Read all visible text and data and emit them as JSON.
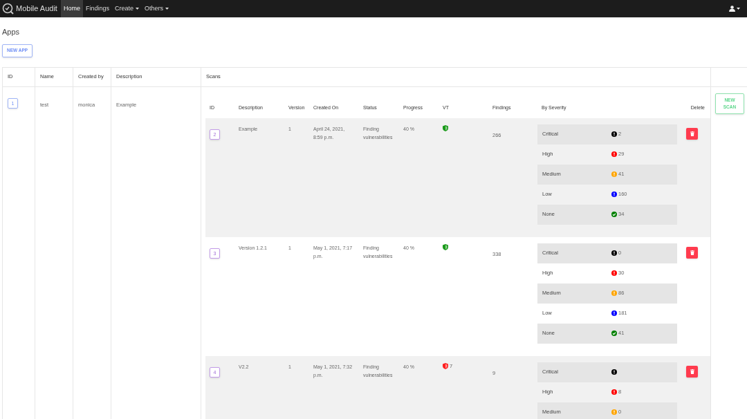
{
  "navbar": {
    "brand": "Mobile Audit",
    "items": [
      {
        "label": "Home",
        "selected": true,
        "dropdown": false
      },
      {
        "label": "Findings",
        "selected": false,
        "dropdown": false
      },
      {
        "label": "Create",
        "selected": false,
        "dropdown": true
      },
      {
        "label": "Others",
        "selected": false,
        "dropdown": true
      }
    ]
  },
  "page_title": "Apps",
  "new_app_button": "NEW APP",
  "apps_table": {
    "columns": [
      "ID",
      "Name",
      "Created by",
      "Description",
      "Scans"
    ],
    "rows": [
      {
        "id": "1",
        "name": "test",
        "created_by": "monica",
        "description": "Example",
        "new_scan_button": "NEW SCAN",
        "scans": {
          "columns": [
            "ID",
            "Description",
            "Version",
            "Created On",
            "Status",
            "Progress",
            "VT",
            "Findings",
            "By Severity",
            "Delete"
          ],
          "rows": [
            {
              "id": "2",
              "description": "Example",
              "version": "1",
              "created_on": "April 24, 2021, 8:59 p.m.",
              "status": "Finding vulnerabilities",
              "progress": "40 %",
              "vt": {
                "kind": "clean"
              },
              "findings": "266",
              "severity": [
                {
                  "label": "Critical",
                  "count": "2",
                  "color": "#000000",
                  "kind": "alert"
                },
                {
                  "label": "High",
                  "count": "29",
                  "color": "#ff0000",
                  "kind": "alert"
                },
                {
                  "label": "Medium",
                  "count": "41",
                  "color": "#ffa500",
                  "kind": "alert"
                },
                {
                  "label": "Low",
                  "count": "160",
                  "color": "#0000ff",
                  "kind": "alert"
                },
                {
                  "label": "None",
                  "count": "34",
                  "color": "#008000",
                  "kind": "check"
                }
              ]
            },
            {
              "id": "3",
              "description": "Version 1.2.1",
              "version": "1",
              "created_on": "May 1, 2021, 7:17 p.m.",
              "status": "Finding vulnerabilities",
              "progress": "40 %",
              "vt": {
                "kind": "clean"
              },
              "findings": "338",
              "severity": [
                {
                  "label": "Critical",
                  "count": "0",
                  "color": "#000000",
                  "kind": "alert"
                },
                {
                  "label": "High",
                  "count": "30",
                  "color": "#ff0000",
                  "kind": "alert"
                },
                {
                  "label": "Medium",
                  "count": "86",
                  "color": "#ffa500",
                  "kind": "alert"
                },
                {
                  "label": "Low",
                  "count": "181",
                  "color": "#0000ff",
                  "kind": "alert"
                },
                {
                  "label": "None",
                  "count": "41",
                  "color": "#008000",
                  "kind": "check"
                }
              ]
            },
            {
              "id": "4",
              "description": "V2.2",
              "version": "1",
              "created_on": "May 1, 2021, 7:32 p.m.",
              "status": "Finding vulnerabilities",
              "progress": "40 %",
              "vt": {
                "kind": "detected",
                "count": "7"
              },
              "findings": "9",
              "severity": [
                {
                  "label": "Critical",
                  "color": "#000000",
                  "kind": "alert"
                },
                {
                  "label": "High",
                  "count": "8",
                  "color": "#ff0000",
                  "kind": "alert"
                },
                {
                  "label": "Medium",
                  "count": "0",
                  "color": "#ffa500",
                  "kind": "alert"
                }
              ]
            }
          ]
        }
      }
    ]
  }
}
